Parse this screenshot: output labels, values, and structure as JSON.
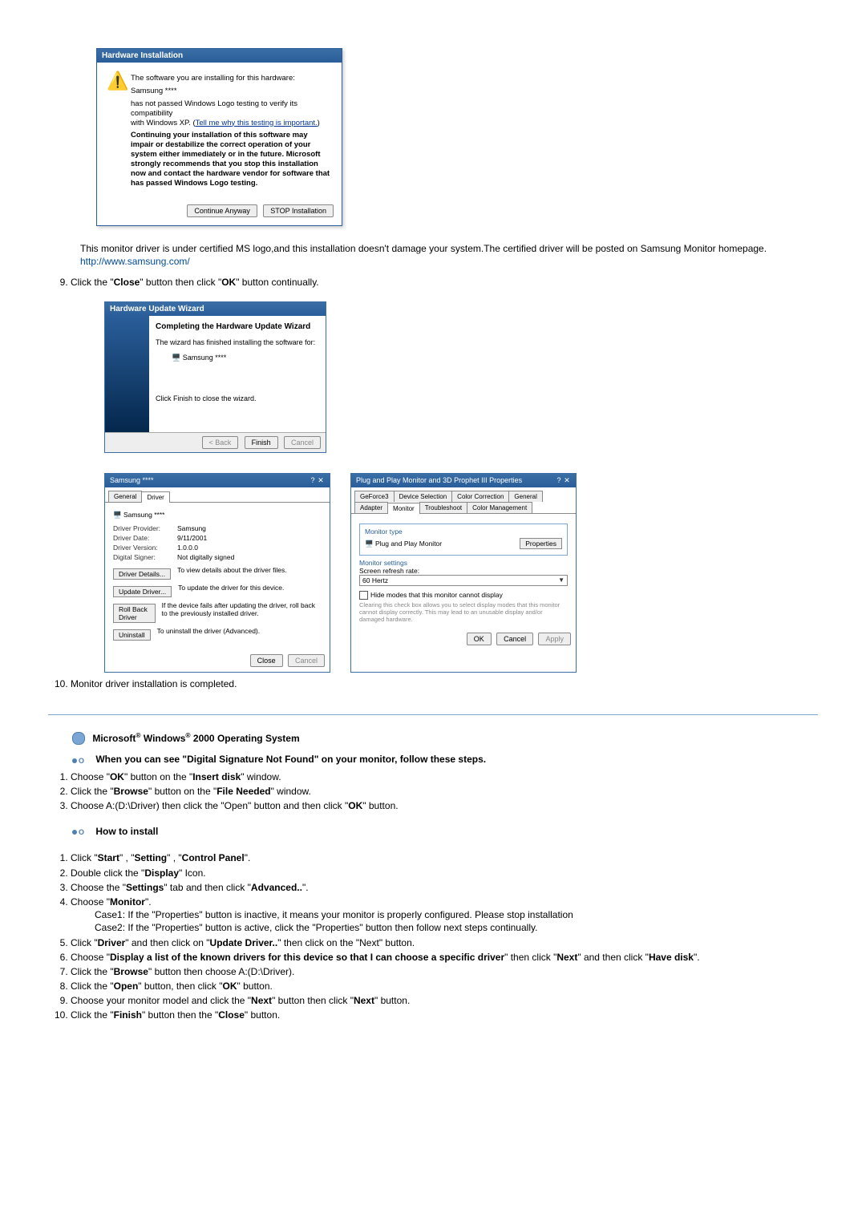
{
  "dlg1": {
    "title": "Hardware Installation",
    "line1": "The software you are installing for this hardware:",
    "dev": "Samsung ****",
    "line2a": "has not passed Windows Logo testing to verify its compatibility",
    "line2b_pre": "with Windows XP. (",
    "line2b_link": "Tell me why this testing is important.",
    "line2b_post": ")",
    "bold": "Continuing your installation of this software may impair or destabilize the correct operation of your system either immediately or in the future. Microsoft strongly recommends that you stop this installation now and contact the hardware vendor for software that has passed Windows Logo testing.",
    "btn_continue": "Continue Anyway",
    "btn_stop": "STOP Installation"
  },
  "note": {
    "text": "This monitor driver is under certified MS logo,and this installation doesn't damage your system.The certified driver will be posted on Samsung Monitor homepage.",
    "link": "http://www.samsung.com/"
  },
  "step9_pre": "Click the \"",
  "step9_b1": "Close",
  "step9_mid": "\" button then click \"",
  "step9_b2": "OK",
  "step9_post": "\" button continually.",
  "wiz": {
    "title": "Hardware Update Wizard",
    "h": "Completing the Hardware Update Wizard",
    "l1": "The wizard has finished installing the software for:",
    "dev": "Samsung ****",
    "l2": "Click Finish to close the wizard.",
    "back": "< Back",
    "finish": "Finish",
    "cancel": "Cancel"
  },
  "prop1": {
    "title": "Samsung ****",
    "tab_general": "General",
    "tab_driver": "Driver",
    "dev": "Samsung ****",
    "r1l": "Driver Provider:",
    "r1v": "Samsung",
    "r2l": "Driver Date:",
    "r2v": "9/11/2001",
    "r3l": "Driver Version:",
    "r3v": "1.0.0.0",
    "r4l": "Digital Signer:",
    "r4v": "Not digitally signed",
    "b1": "Driver Details...",
    "b1d": "To view details about the driver files.",
    "b2": "Update Driver...",
    "b2d": "To update the driver for this device.",
    "b3": "Roll Back Driver",
    "b3d": "If the device fails after updating the driver, roll back to the previously installed driver.",
    "b4": "Uninstall",
    "b4d": "To uninstall the driver (Advanced).",
    "close": "Close",
    "cancel": "Cancel"
  },
  "prop2": {
    "title": "Plug and Play Monitor and 3D Prophet III Properties",
    "t1": "GeForce3",
    "t2": "Device Selection",
    "t3": "Color Correction",
    "t4": "General",
    "t5": "Adapter",
    "t6": "Monitor",
    "t7": "Troubleshoot",
    "t8": "Color Management",
    "grp1": "Monitor type",
    "mon": "Plug and Play Monitor",
    "propbtn": "Properties",
    "grp2": "Monitor settings",
    "srr": "Screen refresh rate:",
    "hz": "60 Hertz",
    "chk": "Hide modes that this monitor cannot display",
    "chkhelp": "Clearing this check box allows you to select display modes that this monitor cannot display correctly. This may lead to an unusable display and/or damaged hardware.",
    "ok": "OK",
    "cancel": "Cancel",
    "apply": "Apply"
  },
  "step10": "Monitor driver installation is completed.",
  "os_head_pre": "Microsoft",
  "os_head_mid": " Windows",
  "os_head_post": " 2000 Operating System",
  "sig_head": "When you can see \"Digital Signature Not Found\" on your monitor, follow these steps.",
  "sig": {
    "s1": [
      "Choose \"",
      "OK",
      "\" button on the \"",
      "Insert disk",
      "\" window."
    ],
    "s2": [
      "Click the \"",
      "Browse",
      "\" button on the \"",
      "File Needed",
      "\" window."
    ],
    "s3": [
      "Choose A:(D:\\Driver) then click the \"Open\" button and then click \"",
      "OK",
      "\" button."
    ]
  },
  "how_head": "How to install",
  "inst": {
    "s1": [
      "Click \"",
      "Start",
      "\" , \"",
      "Setting",
      "\" , \"",
      "Control Panel",
      "\"."
    ],
    "s2": [
      "Double click the \"",
      "Display",
      "\" Icon."
    ],
    "s3": [
      "Choose the \"",
      "Settings",
      "\" tab and then click \"",
      "Advanced..",
      "\"."
    ],
    "s4": [
      "Choose \"",
      "Monitor",
      "\"."
    ],
    "s4c1": "Case1: If the \"Properties\" button is inactive, it means your monitor is properly configured. Please stop installation",
    "s4c2": "Case2: If the \"Properties\" button is active, click the \"Properties\" button then follow next steps continually.",
    "s5": [
      "Click \"",
      "Driver",
      "\" and then click on \"",
      "Update Driver..",
      "\" then click on the \"Next\" button."
    ],
    "s6": [
      "Choose \"",
      "Display a list of the known drivers for this device so that I can choose a specific driver",
      "\" then click \"",
      "Next",
      "\" and then click \"",
      "Have disk",
      "\"."
    ],
    "s7": [
      "Click the \"",
      "Browse",
      "\" button then choose A:(D:\\Driver)."
    ],
    "s8": [
      "Click the \"",
      "Open",
      "\" button, then click \"",
      "OK",
      "\" button."
    ],
    "s9": [
      "Choose your monitor model and click the \"",
      "Next",
      "\" button then click \"",
      "Next",
      "\" button."
    ],
    "s10": [
      "Click the \"",
      "Finish",
      "\" button then the \"",
      "Close",
      "\" button."
    ]
  }
}
